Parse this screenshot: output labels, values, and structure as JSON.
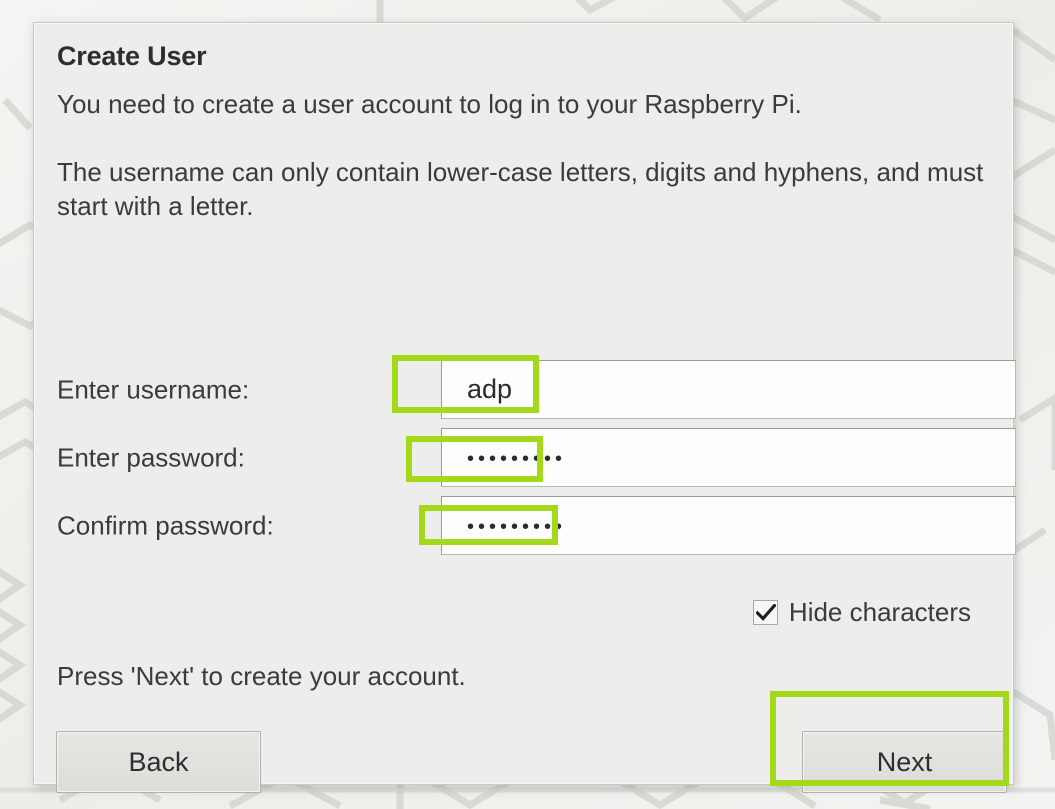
{
  "window": {
    "title": "Create User"
  },
  "body": {
    "paragraph_1": "You need to create a user account to log in to your Raspberry Pi.",
    "paragraph_2": "The username can only contain lower-case letters, digits and hyphens, and must start with a letter."
  },
  "form": {
    "username": {
      "label": "Enter username:",
      "value": "adp",
      "placeholder": ""
    },
    "password": {
      "label": "Enter password:",
      "value": "•••••••••",
      "masked_char_count": 9,
      "placeholder": ""
    },
    "confirm_password": {
      "label": "Confirm password:",
      "value": "•••••••••",
      "masked_char_count": 9,
      "placeholder": ""
    },
    "hide_characters": {
      "label": "Hide characters",
      "checked": true,
      "check_glyph": "check-icon"
    }
  },
  "footer": {
    "note": "Press 'Next' to create your account.",
    "back_label": "Back",
    "next_label": "Next"
  },
  "annotations": {
    "highlight_color": "#a3d91a",
    "targets": [
      "username-field",
      "password-field",
      "confirm-password-field",
      "next-button"
    ]
  },
  "colors": {
    "dialog_background": "#ededeb",
    "desktop_background": "#f2f3f0",
    "text": "#3a3c38",
    "title": "#2d2f2c",
    "field_background": "#fdfdfd",
    "button_background": "#e0e0dc",
    "highlight_green": "#a3d91a"
  }
}
